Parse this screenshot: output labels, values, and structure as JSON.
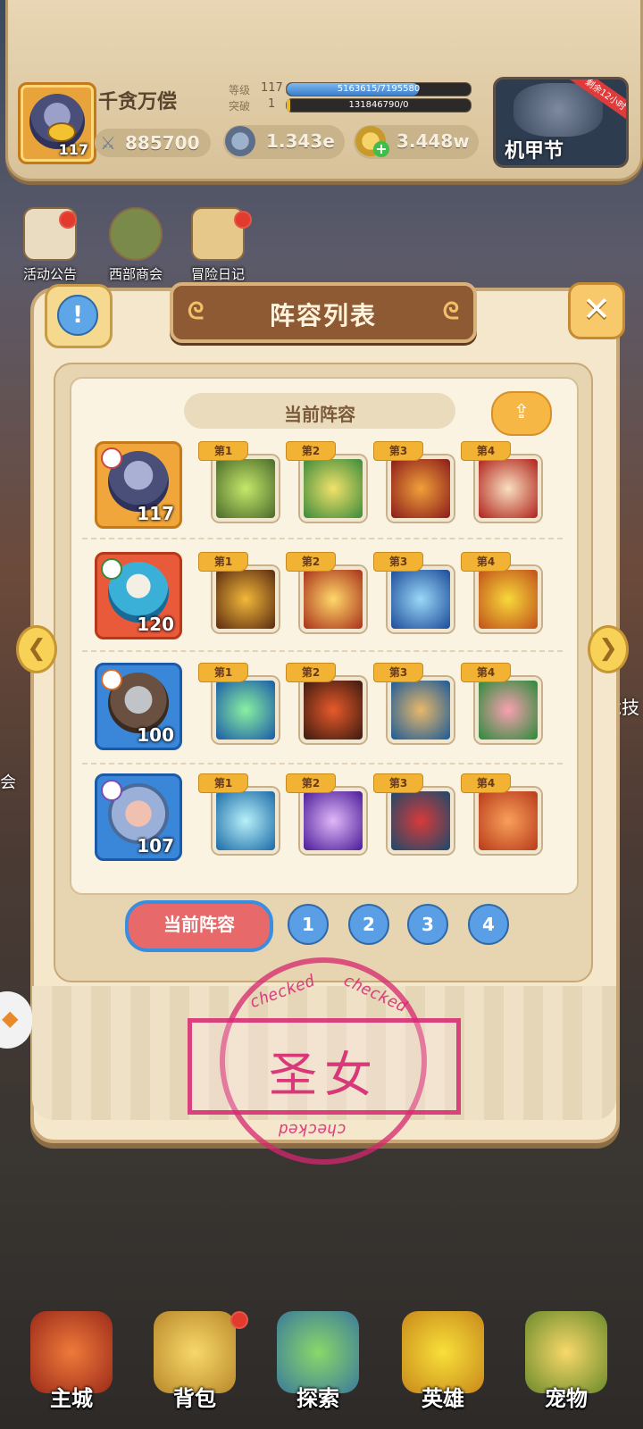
{
  "header": {
    "player_name": "千贪万偿",
    "player_level": "117",
    "power": "885700",
    "level_label": "等级",
    "level_value": "117",
    "exp_text": "5163615/7195580",
    "exp_fraction": 0.72,
    "breakthrough_label": "突破",
    "breakthrough_value": "1",
    "breakthrough_text": "131846790/0",
    "currency1": "1.343e",
    "currency2": "3.448w",
    "event_title": "机甲节",
    "event_tag": "剩余12小时"
  },
  "shortcuts": [
    {
      "label": "活动公告"
    },
    {
      "label": "西部商会"
    },
    {
      "label": "冒险日记"
    }
  ],
  "modal": {
    "title": "阵容列表",
    "current_label": "当前阵容",
    "rows": [
      {
        "level": "117",
        "skills": [
          "第1",
          "第2",
          "第3",
          "第4"
        ]
      },
      {
        "level": "120",
        "skills": [
          "第1",
          "第2",
          "第3",
          "第4"
        ]
      },
      {
        "level": "100",
        "skills": [
          "第1",
          "第2",
          "第3",
          "第4"
        ]
      },
      {
        "level": "107",
        "skills": [
          "第1",
          "第2",
          "第3",
          "第4"
        ]
      }
    ],
    "pager": {
      "current": "当前阵容",
      "pages": [
        "1",
        "2",
        "3",
        "4"
      ]
    }
  },
  "stamp": {
    "text": "圣女",
    "ring_text": "checked"
  },
  "side_text": {
    "left": "会",
    "right": "竞技"
  },
  "nav": [
    {
      "label": "主城"
    },
    {
      "label": "背包"
    },
    {
      "label": "探索"
    },
    {
      "label": "英雄"
    },
    {
      "label": "宠物"
    }
  ],
  "colors": {
    "panel": "#f4e7cc",
    "title_banner": "#8e5a33",
    "accent_blue": "#5a9ee6",
    "accent_red": "#e8696a",
    "stamp": "#d6266e"
  }
}
